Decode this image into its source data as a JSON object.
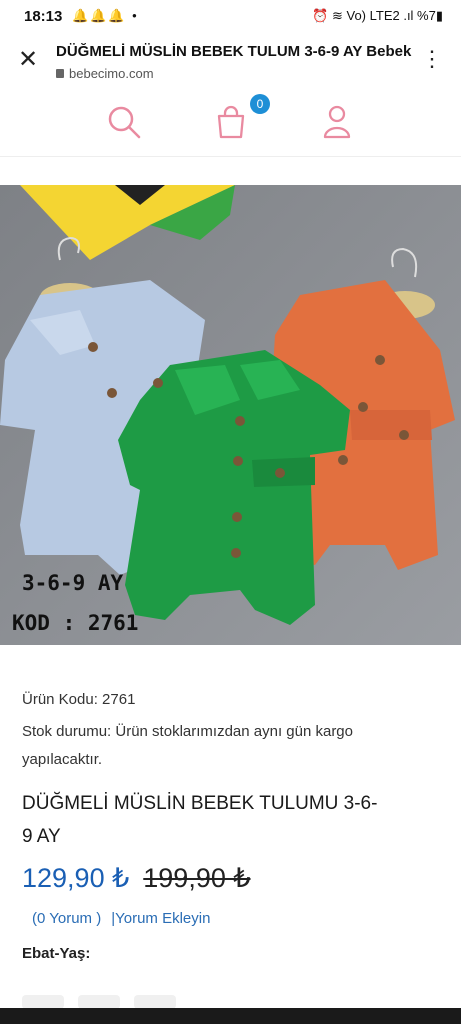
{
  "statusbar": {
    "time": "18:13",
    "notif_icons": "🔔🔔🔔 •",
    "right": "⏰ ≋ Vo) LTE2 .ıl %7▮"
  },
  "urlbar": {
    "title": "DÜĞMELİ MÜSLİN BEBEK TULUM 3-6-9 AY Bebek",
    "domain": "bebecimo.com"
  },
  "nav": {
    "cart_count": "0"
  },
  "image": {
    "size_text": "3-6-9 AY",
    "code_text": "KOD : 2761"
  },
  "product": {
    "code_line": "Ürün Kodu: 2761",
    "stock_line_1": "Stok durumu: Ürün stoklarımızdan aynı gün kargo",
    "stock_line_2": "yapılacaktır.",
    "title_line_1": "DÜĞMELİ MÜSLİN BEBEK TULUMU 3-6-",
    "title_line_2": "9 AY",
    "price": "129,90 ₺",
    "old_price": "199,90 ₺",
    "reviews": "(0 Yorum )",
    "add_review": "|Yorum Ekleyin",
    "size_label": "Ebat-Yaş:"
  },
  "colors": {
    "accent_pink": "#e98aa0",
    "price_blue": "#1a5fb4",
    "badge_blue": "#1e8fd6"
  }
}
